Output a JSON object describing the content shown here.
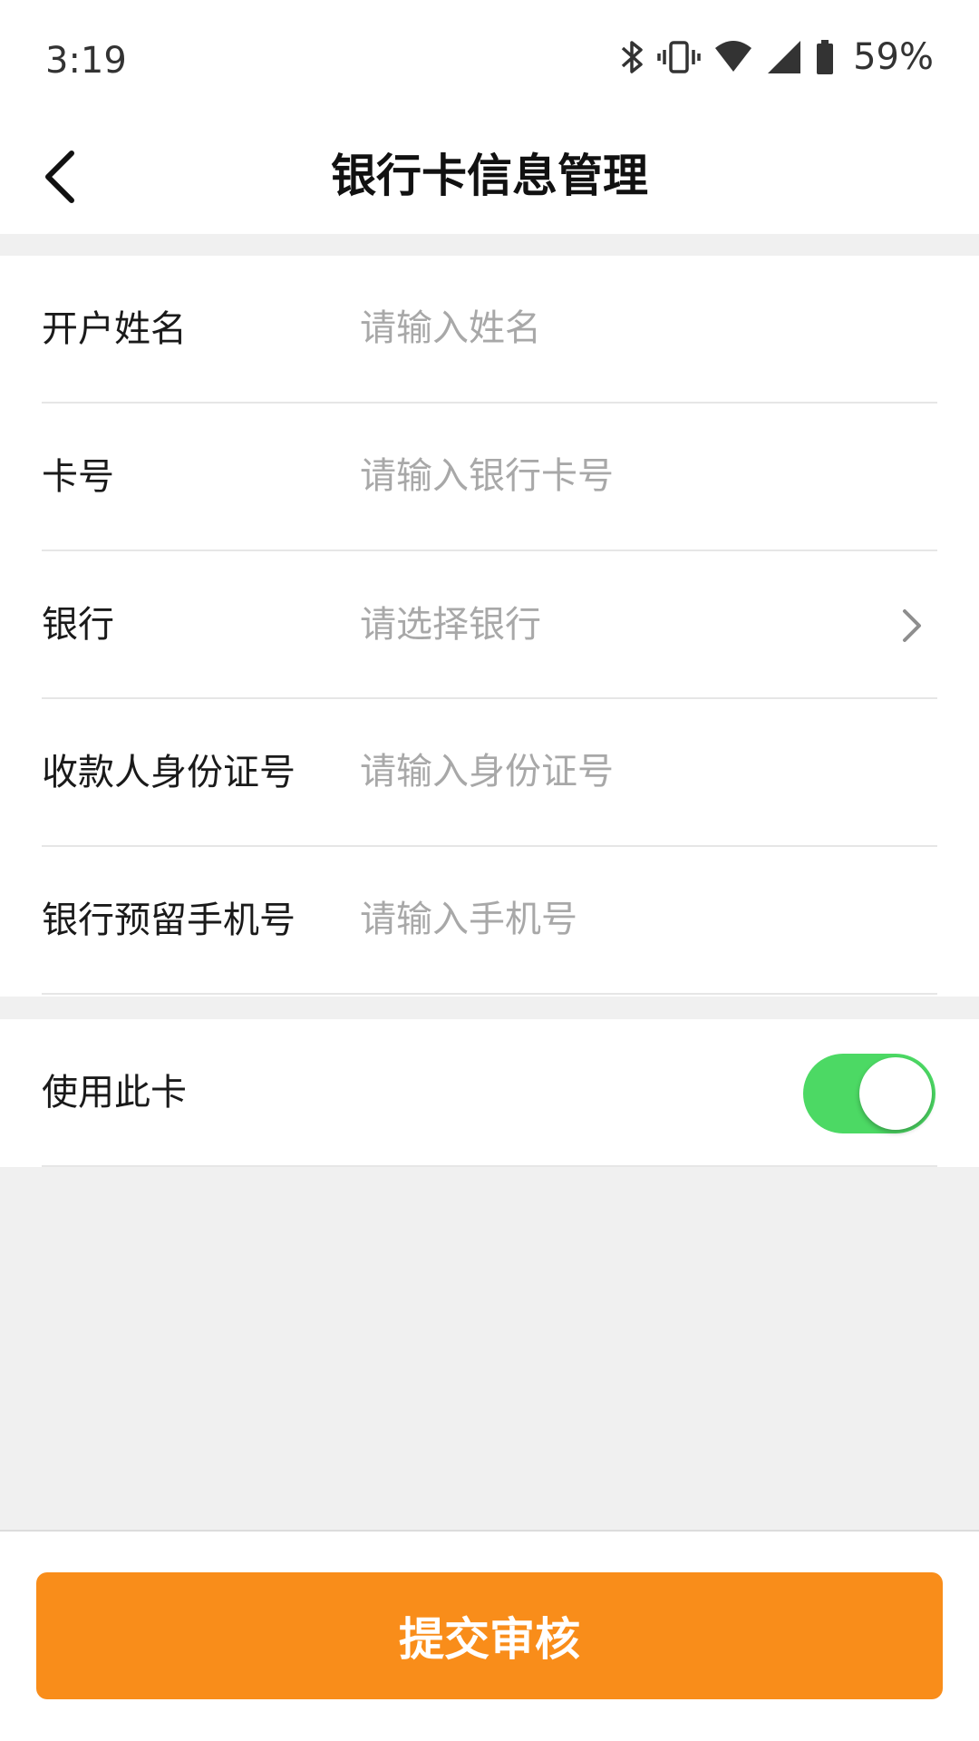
{
  "status_bar": {
    "time": "3:19",
    "battery_percent": "59%",
    "icons": [
      "bluetooth-icon",
      "vibrate-icon",
      "wifi-icon",
      "cellular-signal-icon",
      "battery-icon"
    ]
  },
  "header": {
    "title": "银行卡信息管理",
    "back_icon": "chevron-left-icon"
  },
  "form": {
    "name": {
      "label": "开户姓名",
      "placeholder": "请输入姓名",
      "value": ""
    },
    "card_number": {
      "label": "卡号",
      "placeholder": "请输入银行卡号",
      "value": ""
    },
    "bank": {
      "label": "银行",
      "placeholder": "请选择银行",
      "icon": "chevron-right-icon"
    },
    "id_number": {
      "label": "收款人身份证号",
      "placeholder": "请输入身份证号",
      "value": ""
    },
    "phone": {
      "label": "银行预留手机号",
      "placeholder": "请输入手机号",
      "value": ""
    }
  },
  "use_card": {
    "label": "使用此卡",
    "enabled": true,
    "toggle_color": "#4cd964"
  },
  "footer": {
    "submit_label": "提交审核",
    "button_color": "#f98d1a"
  }
}
